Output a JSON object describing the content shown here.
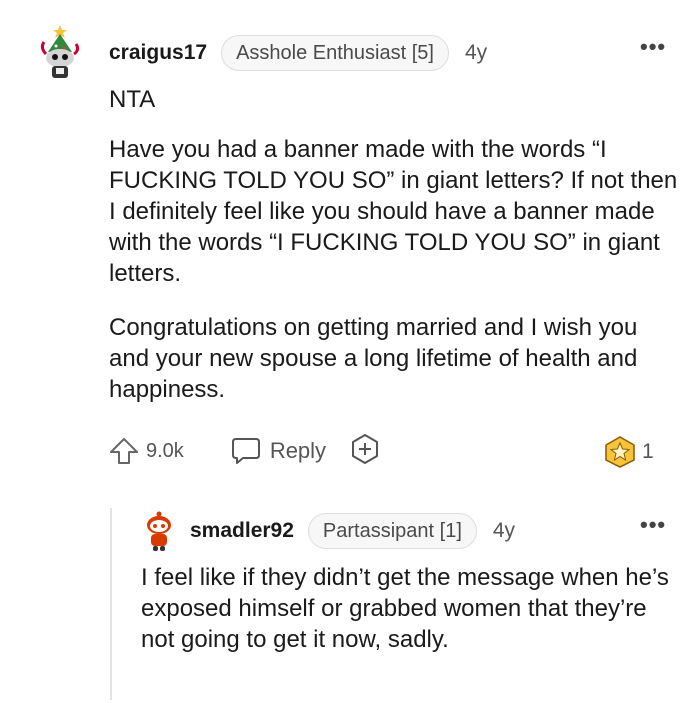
{
  "comment": {
    "username": "craigus17",
    "flair": "Asshole Enthusiast [5]",
    "age": "4y",
    "paragraphs": [
      "NTA",
      "Have you had a banner made with the words “I FUCKING TOLD YOU SO” in giant letters? If not then I definitely feel like you should have a banner made with the words “I FUCKING TOLD YOU SO” in giant letters.",
      "Congratulations on getting married and I wish you and your new spouse a long lifetime of health and happiness."
    ],
    "upvotes": "9.0k",
    "reply_label": "Reply",
    "award_count": "1",
    "more_icon": "more-options-icon"
  },
  "reply": {
    "username": "smadler92",
    "flair": "Partassipant [1]",
    "age": "4y",
    "text": "I feel like if they didn’t get the message when he’s exposed himself or grabbed women that they’re not going to get it now, sadly."
  },
  "colors": {
    "text": "#1a1a1b",
    "muted": "#555555",
    "flair_bg": "#f7f7f7",
    "award_gold": "#f5c43b",
    "avatar_red": "#d93a00"
  }
}
